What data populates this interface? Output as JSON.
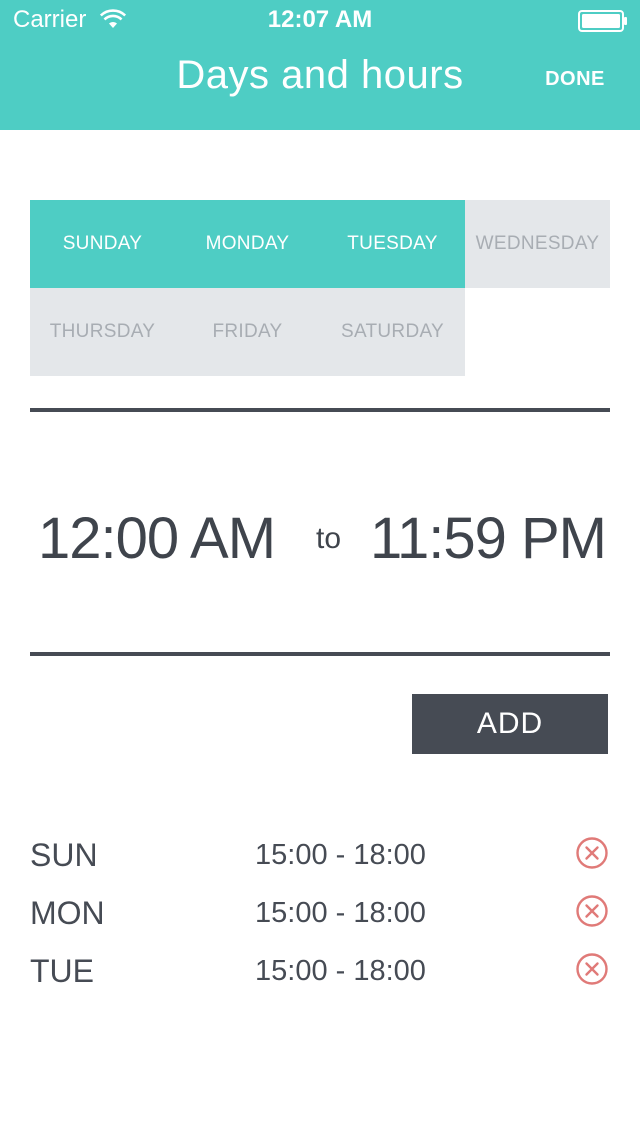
{
  "status_bar": {
    "carrier": "Carrier",
    "time": "12:07 AM",
    "wifi_icon": "wifi-icon",
    "battery_icon": "battery-icon"
  },
  "header": {
    "title": "Days and hours",
    "done_label": "DONE",
    "background_color": "#4ecdc4"
  },
  "days": [
    {
      "label": "SUNDAY",
      "selected": true
    },
    {
      "label": "MONDAY",
      "selected": true
    },
    {
      "label": "TUESDAY",
      "selected": true
    },
    {
      "label": "WEDNESDAY",
      "selected": false
    },
    {
      "label": "THURSDAY",
      "selected": false
    },
    {
      "label": "FRIDAY",
      "selected": false
    },
    {
      "label": "SATURDAY",
      "selected": false
    }
  ],
  "time_range": {
    "start": "12:00 AM",
    "separator": "to",
    "end": "11:59 PM"
  },
  "add_button": {
    "label": "ADD"
  },
  "schedule": [
    {
      "day": "SUN",
      "range": "15:00 - 18:00",
      "remove_icon": "remove-circle-x-icon"
    },
    {
      "day": "MON",
      "range": "15:00 - 18:00",
      "remove_icon": "remove-circle-x-icon"
    },
    {
      "day": "TUE",
      "range": "15:00 - 18:00",
      "remove_icon": "remove-circle-x-icon"
    }
  ],
  "colors": {
    "accent": "#4ecdc4",
    "dark": "#464b54",
    "unselected_bg": "#e4e7ea",
    "unselected_text": "#a8adb3",
    "remove_red": "#e07a78"
  }
}
